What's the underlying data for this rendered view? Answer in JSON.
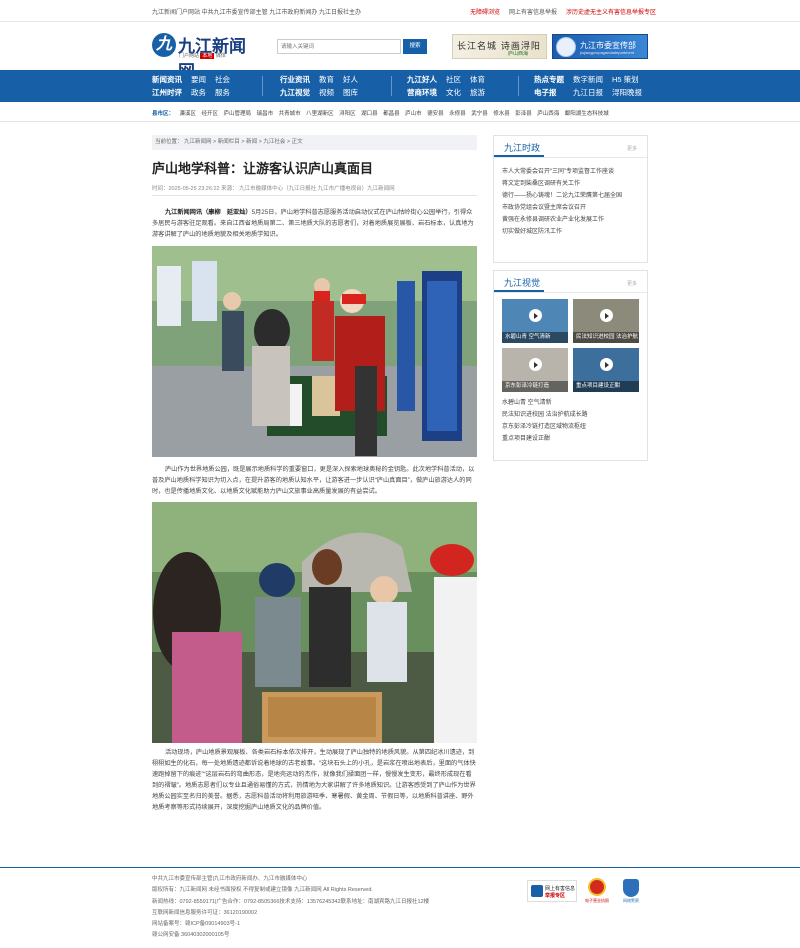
{
  "topbar": {
    "left_text": "九江新闻门户网站 中共九江市委宣传部主管 九江市政府新闻办 九江日报社主办",
    "links": [
      "无障碍浏览",
      "网上有害信息举报",
      "涉历史虚无主义有害信息举报专区"
    ]
  },
  "header": {
    "logo_mark": "九",
    "logo_title": "九江新闻网",
    "logo_sub": "门户网站",
    "logo_badge": "本地",
    "logo_sub2": "媒体",
    "search_placeholder": "请输入关键词",
    "search_button": "搜索",
    "banner1_text": "长江名城 诗画浔阳",
    "banner1_sub": "庐山西海",
    "banner2_text": "九江市委宣传部",
    "banner2_sub": "jiujiangpropagandadepartment"
  },
  "nav": {
    "groups": [
      {
        "items": [
          "新闻资讯",
          "要闻",
          "社会",
          "江州时评",
          "政务",
          "服务"
        ]
      },
      {
        "items": [
          "行业资讯",
          "教育",
          "好人",
          "九江视觉",
          "视频",
          "图库"
        ]
      },
      {
        "items": [
          "九江好人",
          "社区",
          "体育",
          "营商环境",
          "文化",
          "旅游"
        ]
      },
      {
        "items": [
          "热点专题",
          "数字新闻",
          "H5 策划",
          "电子报",
          "九江日报",
          "浔阳晚报"
        ]
      }
    ]
  },
  "county": {
    "label": "县市区：",
    "items": [
      "濂溪区",
      "经开区",
      "庐山管理局",
      "瑞昌市",
      "共青城市",
      "八里湖新区",
      "浔阳区",
      "湖口县",
      "都昌县",
      "庐山市",
      "德安县",
      "永修县",
      "武宁县",
      "修水县",
      "彭泽县",
      "庐山西海",
      "鄱阳湖生态科技城"
    ]
  },
  "article": {
    "breadcrumb": "当前位置： 九江新闻网 > 新闻栏目 > 新闻 > 九江社会 > 正文",
    "title": "庐山地学科普：让游客认识庐山真面目",
    "meta": "时间：2025-05-25 23:26:22    来源： 九江市融媒体中心（九江日报社 九江市广播电视台）九江新闻网",
    "p1_lead": "九江新闻网讯（康柳　延亚灿）",
    "p1": "5月25日，庐山地学科普志愿服务活动启动仪式在庐山牯岭街心公园举行，引得众多居民与游客驻足观看。来自江西省地质局第二、第三地质大队的志愿者们，对着地质展览展板、岩石标本，认真地为游客讲解了庐山的地质地貌及相关地质学知识。",
    "p2": "庐山作为世界地质公园，既是展示地质科学的重要窗口，更是深入探索地球奥秘的金钥匙。此次地学科普活动，以普及庐山地质科学知识为切入点，在提升游客的地质认知水平，让游客进一步认识“庐山真面目”，做庐山旅游达人的同时，也是传播地质文化、以地质文化赋能助力庐山文旅事业高质量发展的有益尝试。",
    "p3": "活动现场，庐山地质景观展板、各类岩石标本依次排开，生动展现了庐山独特的地质风貌。从第四纪冰川遗迹，到栩栩如生的化石，每一处地质遗迹都诉说着地球的古老故事。“这块石头上的小孔，是岩浆在喷出地表后，里面的气体快速跑掉留下的痕迹”“这层岩石的弯曲形态，是地壳运动的杰作，就像我们揉面团一样，慢慢发生变形，最终形成现在看到的褶皱”。地质志愿者们以专业且通俗易懂的方式，热情地为大家讲解了许多地质知识。让游客感受到了庐山作为世界地质公园实至名归的美誉。据悉，志愿科普活动将利用旅游旺季、寒暑假、黄金周、节假日等，以地质科普讲座、野外地质考察等形式持续展开，深度挖掘庐山地质文化的品牌价值。"
  },
  "sidebar": {
    "news": {
      "title": "九江时政",
      "more": "更多",
      "items": [
        "市人大常委会召开“三同”专项监督工作座谈",
        "蒋文定到柴桑区调研有关工作",
        "德行——扬心铸魂！二论九江荣膺第七届全国",
        "市政协党组会议暨主席会议召开",
        "黄强在永修县调研农业产业化发展工作",
        "切实做好城区防汛工作"
      ]
    },
    "visual": {
      "title": "九江视觉",
      "more": "更多",
      "thumbs": [
        "水碧山青 空气清新",
        "民法知识进校园 法治护航",
        "京东彭泽冷链打造",
        "重点项目建设正酣"
      ],
      "items": [
        "水碧山青 空气清新",
        "民法知识进校园 法治护航成长路",
        "京东彭泽冷链打造区域物流枢纽",
        "重点项目建设正酣"
      ]
    }
  },
  "footer": {
    "lines": [
      "中共九江市委宣传部主管|九江市政府新闻办、九江市融媒体中心",
      "版权所有：九江新闻网 未经书面授权 不得复制或建立镜像 九江新闻网 All Rights Reserved.",
      "新闻热线：0792-8559171|广告合作：0792-8505366技术支持：13576245342联系地址：南湖宾路九江日报社12楼",
      "互联网新闻信息服务许可证：36120190002",
      "网站备案号：赣ICP备09014903号-1",
      "赣公网安备 36040302000105号"
    ],
    "badge1_line1": "网上有害信息",
    "badge1_line2": "举报专区",
    "badge2_text": "电子营业执照",
    "badge3_text": "网络警察"
  },
  "colors": {
    "brand_blue": "#1760a8",
    "alert_red": "#cc0000"
  }
}
